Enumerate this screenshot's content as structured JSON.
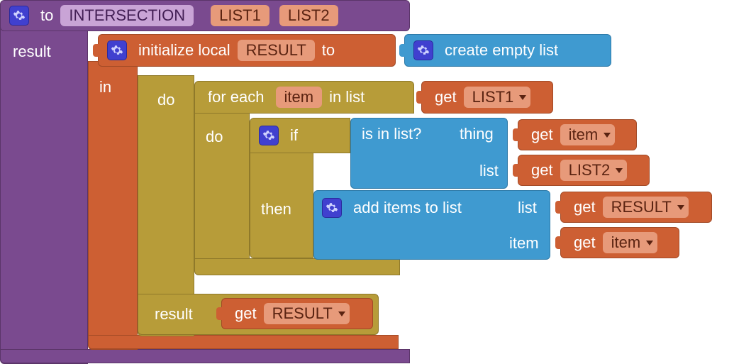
{
  "proc": {
    "to": "to",
    "name": "INTERSECTION",
    "params": [
      "LIST1",
      "LIST2"
    ],
    "result_kw": "result"
  },
  "init_local": {
    "label": "initialize local",
    "varname": "RESULT",
    "to": "to",
    "in": "in"
  },
  "create_empty": "create empty list",
  "foreach": {
    "do_outer": "do",
    "label": "for each",
    "varname": "item",
    "in_list": "in list",
    "do": "do",
    "result_kw": "result"
  },
  "get": "get",
  "vars": {
    "LIST1": "LIST1",
    "LIST2": "LIST2",
    "RESULT": "RESULT",
    "item": "item"
  },
  "if": {
    "if": "if",
    "then": "then"
  },
  "is_in_list": {
    "label": "is in list?",
    "thing": "thing",
    "list": "list"
  },
  "add_items": {
    "label": "add items to list",
    "list": "list",
    "item": "item"
  },
  "colors": {
    "purple": "#7a4a8f",
    "orange": "#cd5f33",
    "olive": "#b79c39",
    "blue": "#3f9ad0",
    "gear": "#4040cf",
    "chip_purple": "#c9a4d6",
    "chip_orange": "#e79a7a"
  }
}
